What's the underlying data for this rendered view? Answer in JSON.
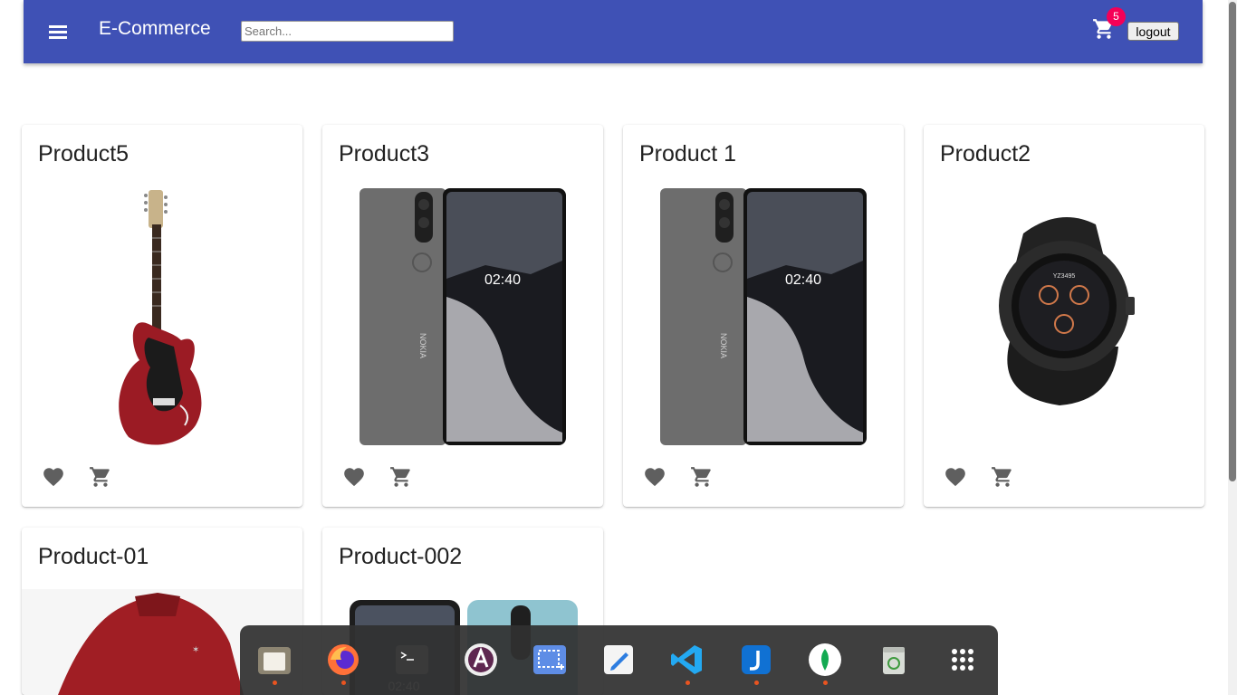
{
  "header": {
    "title": "E-Commerce",
    "search_placeholder": "Search...",
    "cart_count": "5",
    "logout_label": "logout",
    "color": "#3f51b5",
    "badge_color": "#f50057"
  },
  "products": [
    {
      "title": "Product5",
      "image": "red-electric-guitar"
    },
    {
      "title": "Product3",
      "image": "nokia-smartphone"
    },
    {
      "title": "Product 1",
      "image": "nokia-smartphone"
    },
    {
      "title": "Product2",
      "image": "black-smartwatch"
    },
    {
      "title": "Product-01",
      "image": "red-sports-top"
    },
    {
      "title": "Product-002",
      "image": "smartphones-pair"
    }
  ],
  "phone_clock": "02:40",
  "phone_brand": "NOKIA",
  "watch_time": "YZ3495",
  "dock": {
    "items": [
      "files-icon",
      "firefox-icon",
      "terminal-icon",
      "app-center-icon",
      "screenshot-icon",
      "text-editor-icon",
      "vscode-icon",
      "joplin-icon",
      "mongodb-compass-icon",
      "trash-icon",
      "app-grid-icon"
    ],
    "running_dot_color": "#e95420"
  }
}
